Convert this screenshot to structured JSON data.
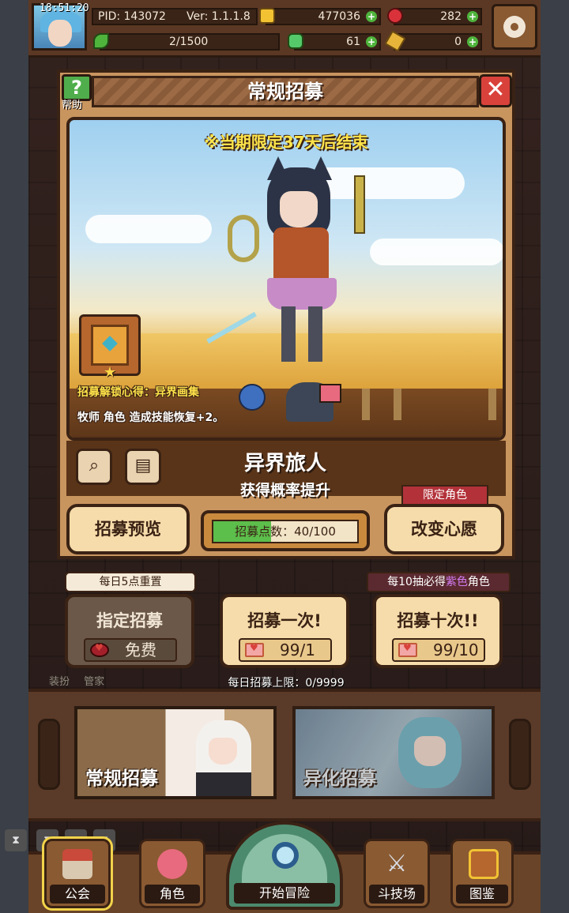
{
  "status_bar": {
    "time": "18:51:20",
    "pid": "PID: 143072",
    "version": "Ver: 1.1.1.8",
    "gold": "477036",
    "gems": "282",
    "stamina": "2/1500",
    "clover": "61",
    "key": "0"
  },
  "panel": {
    "help_label": "帮助",
    "title": "常规招募",
    "close_glyph": "✕",
    "limited_notice": "※当期限定37天后结束",
    "perk_title": "招募解锁心得：异界画集",
    "perk_desc": "牧师 角色 造成技能恢复+2。",
    "character_name": "异界旅人",
    "character_sub": "获得概率提升",
    "preview_button": "招募预览",
    "points_label": "招募点数：40/100",
    "points_progress": 0.4,
    "limited_role_tag": "限定角色",
    "change_wish_button": "改变心愿"
  },
  "gacha": {
    "daily_reset_tag": "每日5点重置",
    "pity_prefix": "每10抽必得",
    "pity_highlight": "紫色",
    "pity_suffix": "角色",
    "designated": {
      "label": "指定招募",
      "cost": "免费"
    },
    "single": {
      "label": "招募一次!",
      "cost": "99/1"
    },
    "ten": {
      "label": "招募十次!!",
      "cost": "99/10"
    },
    "daily_limit": "每日招募上限：0/9999"
  },
  "pools": [
    {
      "label": "常规招募"
    },
    {
      "label": "异化招募"
    }
  ],
  "background_labels": {
    "dress": "装扮",
    "butler": "管家"
  },
  "nav": [
    {
      "label": "公会",
      "icon": "guild-house-icon"
    },
    {
      "label": "角色",
      "icon": "character-icon"
    },
    {
      "label": "开始冒险",
      "icon": "magnifier-icon"
    },
    {
      "label": "斗技场",
      "icon": "crossed-swords-icon"
    },
    {
      "label": "图鉴",
      "icon": "codex-book-icon"
    }
  ],
  "colors": {
    "accent_yellow": "#ffe54a",
    "button_cream": "#f6dcaa",
    "progress_green": "#5cbe4b",
    "purple_highlight": "#d47cf4"
  }
}
